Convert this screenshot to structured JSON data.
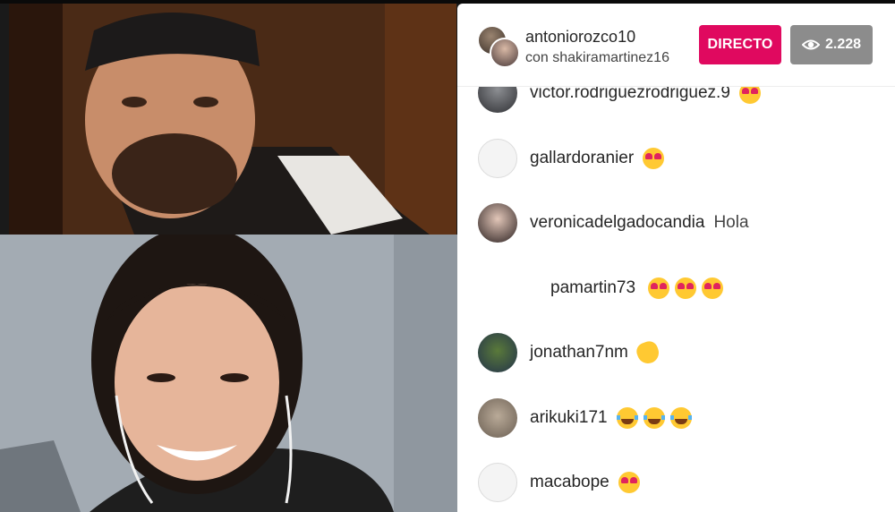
{
  "header": {
    "host_username": "antoniorozco10",
    "with_text": "con shakiramartinez16",
    "live_label": "DIRECTO",
    "viewer_count": "2.228",
    "viewer_icon": "eye-icon"
  },
  "comments": [
    {
      "user": "victor.rodriguezrodriguez.9",
      "text": "",
      "emojis": [
        "heart-eyes"
      ],
      "avatar": "photo"
    },
    {
      "user": "gallardoranier",
      "text": "",
      "emojis": [
        "heart-eyes"
      ],
      "avatar": "empty"
    },
    {
      "user": "veronicadelgadocandia",
      "text": "Hola",
      "emojis": [],
      "avatar": "photo"
    },
    {
      "user": "pamartin73",
      "text": "",
      "emojis": [
        "heart-eyes",
        "heart-eyes",
        "heart-eyes"
      ],
      "avatar": "none"
    },
    {
      "user": "jonathan7nm",
      "text": "",
      "emojis": [
        "clapping-hands"
      ],
      "avatar": "photo"
    },
    {
      "user": "arikuki171",
      "text": "",
      "emojis": [
        "tears-of-joy",
        "tears-of-joy",
        "tears-of-joy"
      ],
      "avatar": "photo"
    },
    {
      "user": "macabope",
      "text": "",
      "emojis": [
        "heart-eyes"
      ],
      "avatar": "empty"
    }
  ],
  "colors": {
    "live_badge": "#e0095f",
    "viewer_badge": "#8c8c8c",
    "panel_bg": "#ffffff",
    "text": "#262626"
  }
}
